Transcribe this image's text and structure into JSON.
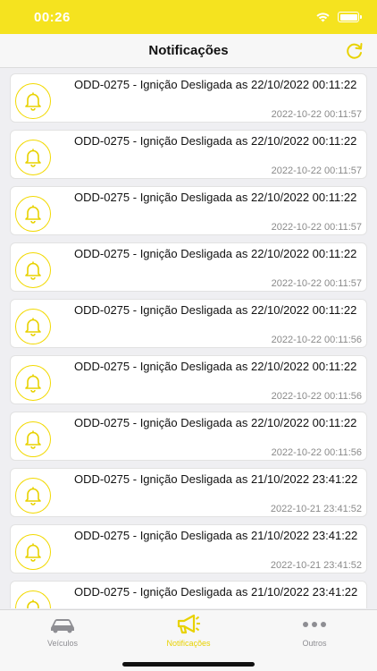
{
  "status_bar": {
    "time": "00:26"
  },
  "nav": {
    "title": "Notificações",
    "refresh_icon": "refresh-icon"
  },
  "notifications": [
    {
      "message": "ODD-0275 - Ignição Desligada as 22/10/2022 00:11:22",
      "timestamp": "2022-10-22 00:11:57"
    },
    {
      "message": "ODD-0275 - Ignição Desligada as 22/10/2022 00:11:22",
      "timestamp": "2022-10-22 00:11:57"
    },
    {
      "message": "ODD-0275 - Ignição Desligada as 22/10/2022 00:11:22",
      "timestamp": "2022-10-22 00:11:57"
    },
    {
      "message": "ODD-0275 - Ignição Desligada as 22/10/2022 00:11:22",
      "timestamp": "2022-10-22 00:11:57"
    },
    {
      "message": "ODD-0275 - Ignição Desligada as 22/10/2022 00:11:22",
      "timestamp": "2022-10-22 00:11:56"
    },
    {
      "message": "ODD-0275 - Ignição Desligada as 22/10/2022 00:11:22",
      "timestamp": "2022-10-22 00:11:56"
    },
    {
      "message": "ODD-0275 - Ignição Desligada as 22/10/2022 00:11:22",
      "timestamp": "2022-10-22 00:11:56"
    },
    {
      "message": "ODD-0275 - Ignição Desligada as 21/10/2022 23:41:22",
      "timestamp": "2022-10-21 23:41:52"
    },
    {
      "message": "ODD-0275 - Ignição Desligada as 21/10/2022 23:41:22",
      "timestamp": "2022-10-21 23:41:52"
    },
    {
      "message": "ODD-0275 - Ignição Desligada as 21/10/2022 23:41:22",
      "timestamp": ""
    }
  ],
  "tabs": [
    {
      "label": "Veículos",
      "icon": "car-icon",
      "active": false
    },
    {
      "label": "Notificações",
      "icon": "megaphone-icon",
      "active": true
    },
    {
      "label": "Outros",
      "icon": "more-icon",
      "active": false
    }
  ],
  "colors": {
    "accent": "#f5e31f",
    "active_tab": "#e8d200",
    "inactive_tab": "#8e8e93"
  }
}
